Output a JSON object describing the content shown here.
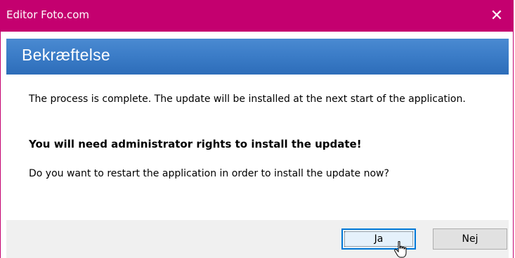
{
  "window": {
    "title": "Editor Foto.com",
    "close_glyph": "✕",
    "accent_color": "#c4006f"
  },
  "header": {
    "title": "Bekræftelse",
    "color": "#3c7dc8"
  },
  "message": {
    "line1": "The process is complete. The update will be installed at the next start of the application.",
    "warning": "You will need administrator rights to install the update!",
    "question": "Do you want to restart the application in order to install the update now?"
  },
  "buttons": {
    "yes_label": "Ja",
    "no_label": "Nej"
  },
  "cursor": {
    "icon": "hand-pointer-icon"
  }
}
